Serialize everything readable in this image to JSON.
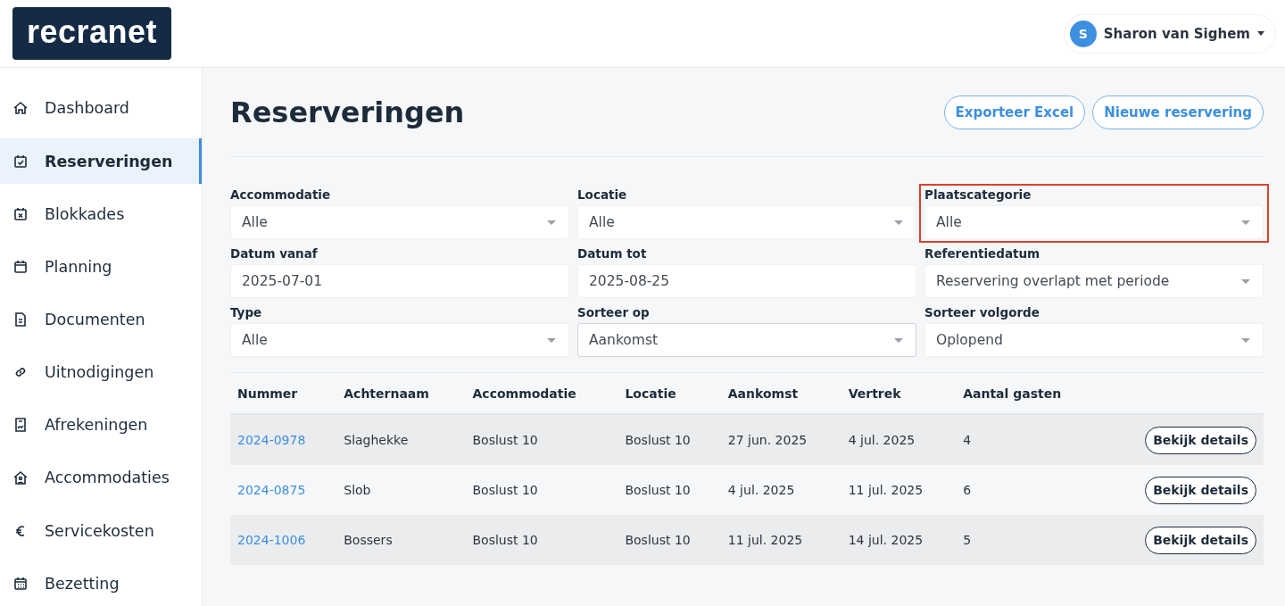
{
  "logo": "recranet",
  "user": {
    "initial": "S",
    "name": "Sharon van Sighem"
  },
  "sidebar": {
    "items": [
      {
        "label": "Dashboard",
        "selected": false
      },
      {
        "label": "Reserveringen",
        "selected": true
      },
      {
        "label": "Blokkades",
        "selected": false
      },
      {
        "label": "Planning",
        "selected": false
      },
      {
        "label": "Documenten",
        "selected": false
      },
      {
        "label": "Uitnodigingen",
        "selected": false
      },
      {
        "label": "Afrekeningen",
        "selected": false
      },
      {
        "label": "Accommodaties",
        "selected": false
      },
      {
        "label": "Servicekosten",
        "selected": false
      },
      {
        "label": "Bezetting",
        "selected": false
      }
    ]
  },
  "page_title": "Reserveringen",
  "actions": [
    "Exporteer Excel",
    "Nieuwe reservering"
  ],
  "filters": [
    {
      "label": "Accommodatie",
      "value": "Alle",
      "kind": "select",
      "highlighted": false,
      "focused": false
    },
    {
      "label": "Locatie",
      "value": "Alle",
      "kind": "select",
      "highlighted": false,
      "focused": false
    },
    {
      "label": "Plaatscategorie",
      "value": "Alle",
      "kind": "select",
      "highlighted": true,
      "focused": false
    },
    {
      "label": "Datum vanaf",
      "value": "2025-07-01",
      "kind": "date",
      "highlighted": false,
      "focused": false
    },
    {
      "label": "Datum tot",
      "value": "2025-08-25",
      "kind": "date",
      "highlighted": false,
      "focused": false
    },
    {
      "label": "Referentiedatum",
      "value": "Reservering overlapt met periode",
      "kind": "select",
      "highlighted": false,
      "focused": false
    },
    {
      "label": "Type",
      "value": "Alle",
      "kind": "select",
      "highlighted": false,
      "focused": false
    },
    {
      "label": "Sorteer op",
      "value": "Aankomst",
      "kind": "select",
      "highlighted": false,
      "focused": true
    },
    {
      "label": "Sorteer volgorde",
      "value": "Oplopend",
      "kind": "select",
      "highlighted": false,
      "focused": false
    }
  ],
  "table": {
    "columns": [
      "Nummer",
      "Achternaam",
      "Accommodatie",
      "Locatie",
      "Aankomst",
      "Vertrek",
      "Aantal gasten"
    ],
    "rows": [
      {
        "cells": [
          "2024-0978",
          "Slaghekke",
          "Boslust 10",
          "Boslust 10",
          "27 jun. 2025",
          "4 jul. 2025",
          "4"
        ],
        "action": "Bekijk details"
      },
      {
        "cells": [
          "2024-0875",
          "Slob",
          "Boslust 10",
          "Boslust 10",
          "4 jul. 2025",
          "11 jul. 2025",
          "6"
        ],
        "action": "Bekijk details"
      },
      {
        "cells": [
          "2024-1006",
          "Bossers",
          "Boslust 10",
          "Boslust 10",
          "11 jul. 2025",
          "14 jul. 2025",
          "5"
        ],
        "action": "Bekijk details"
      }
    ]
  }
}
